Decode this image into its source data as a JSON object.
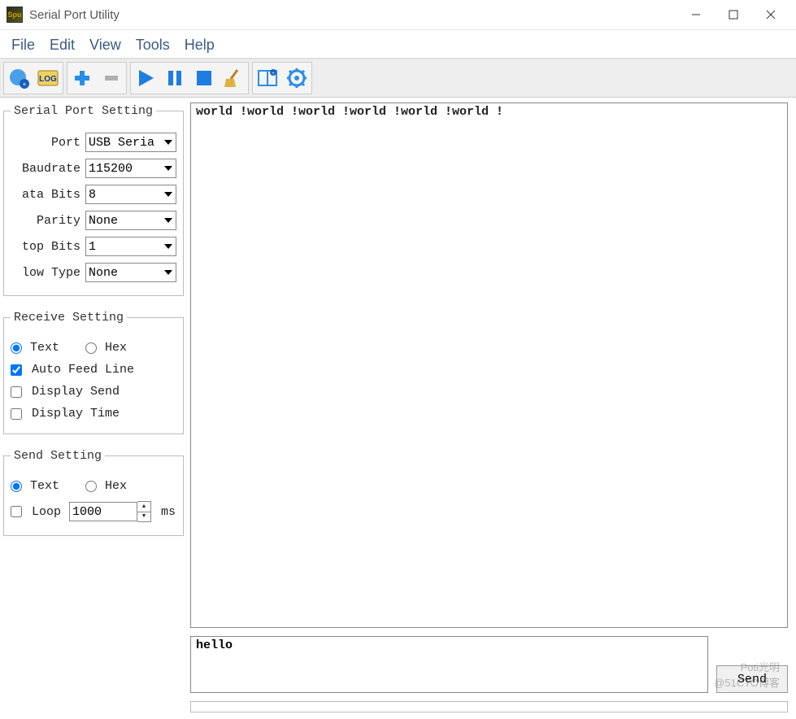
{
  "window": {
    "title": "Serial Port Utility",
    "app_icon_label": "Spu"
  },
  "menu": {
    "file": "File",
    "edit": "Edit",
    "view": "View",
    "tools": "Tools",
    "help": "Help"
  },
  "toolbar_icons": {
    "add_device": "add-device-icon",
    "log": "log-icon",
    "plus": "plus-icon",
    "minus": "minus-icon",
    "play": "play-icon",
    "pause": "pause-icon",
    "stop": "stop-icon",
    "broom": "broom-icon",
    "columns": "columns-icon",
    "settings": "gear-icon"
  },
  "serial_port": {
    "legend": "Serial Port Setting",
    "port_label": "Port",
    "port_value": "USB Seria",
    "baud_label": "Baudrate",
    "baud_value": "115200",
    "data_bits_label": "ata Bits",
    "data_bits_value": "8",
    "parity_label": "Parity",
    "parity_value": "None",
    "stop_bits_label": "top Bits",
    "stop_bits_value": "1",
    "flow_label": "low Type",
    "flow_value": "None"
  },
  "receive": {
    "legend": "Receive Setting",
    "text_label": "Text",
    "hex_label": "Hex",
    "mode_selected": "text",
    "auto_feed": "Auto Feed Line",
    "auto_feed_checked": true,
    "display_send": "Display Send",
    "display_send_checked": false,
    "display_time": "Display Time",
    "display_time_checked": false
  },
  "send": {
    "legend": "Send Setting",
    "text_label": "Text",
    "hex_label": "Hex",
    "mode_selected": "text",
    "loop_label": "Loop",
    "loop_checked": false,
    "loop_interval": "1000",
    "loop_unit": "ms",
    "input_value": "hello",
    "button_label": "Send"
  },
  "output_text": "world !world !world !world !world !world !",
  "watermark": {
    "line1": "Poti光明",
    "line2": "@51CTO博客"
  }
}
